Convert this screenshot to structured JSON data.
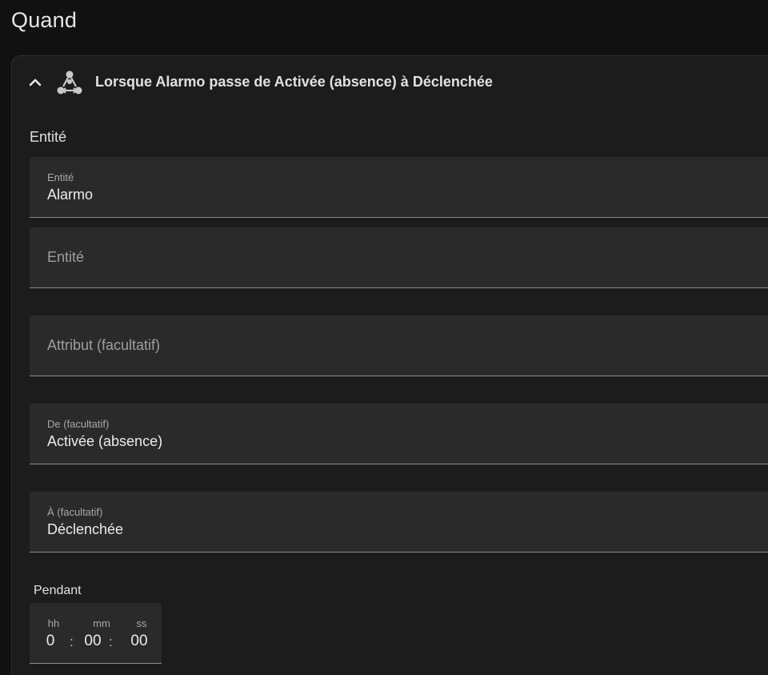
{
  "section": {
    "title": "Quand"
  },
  "trigger": {
    "header_title": "Lorsque Alarmo passe de Activée (absence) à Déclenchée",
    "icons": {
      "collapse": "chevron-up-icon",
      "type": "state-trigger-icon"
    },
    "entity_group_label": "Entité",
    "fields": {
      "entity": {
        "label": "Entité",
        "value": "Alarmo"
      },
      "entity_extra": {
        "placeholder": "Entité"
      },
      "attribute": {
        "placeholder": "Attribut (facultatif)"
      },
      "from": {
        "label": "De (facultatif)",
        "value": "Activée (absence)"
      },
      "to": {
        "label": "À (facultatif)",
        "value": "Déclenchée"
      }
    },
    "duration": {
      "label": "Pendant",
      "hours_label": "hh",
      "minutes_label": "mm",
      "seconds_label": "ss",
      "hours": "0",
      "minutes": "00",
      "seconds": "00",
      "separator": ":"
    }
  },
  "colors": {
    "background": "#111111",
    "card": "#1c1c1c",
    "field": "#2a2a2a",
    "text": "#e1e1e1",
    "muted": "#a8a8a8"
  }
}
